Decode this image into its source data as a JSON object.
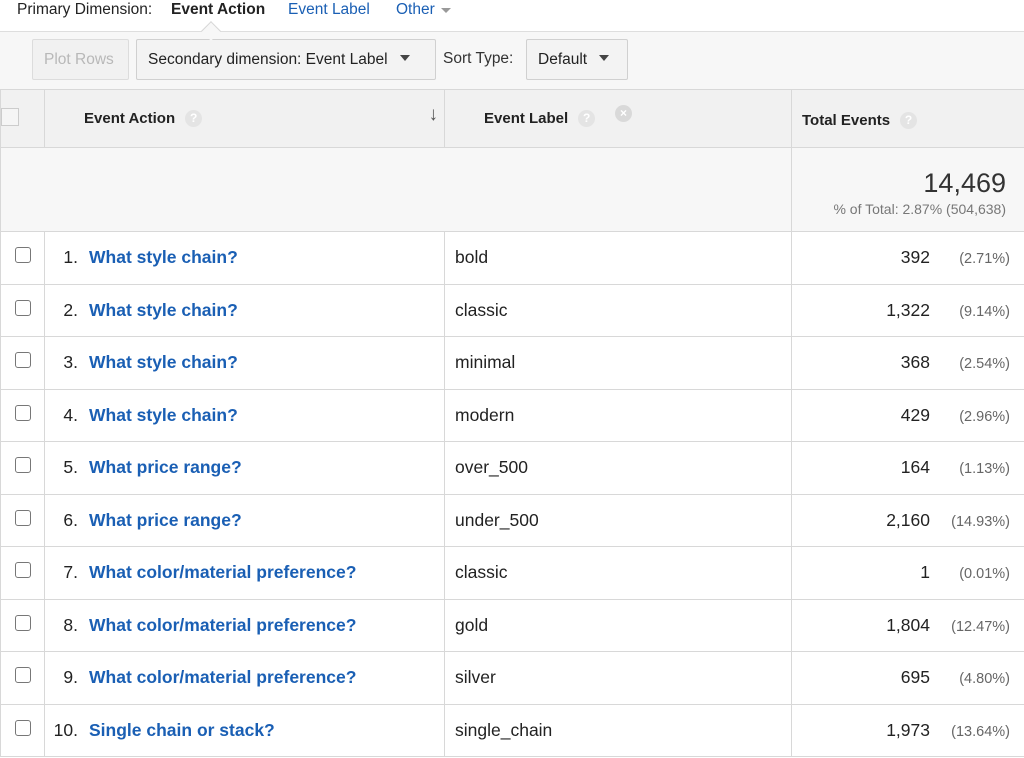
{
  "dimension_bar": {
    "label": "Primary Dimension:",
    "active": "Event Action",
    "option_event_label": "Event Label",
    "option_other": "Other"
  },
  "toolbar": {
    "plot_rows": "Plot Rows",
    "secondary_dimension": "Secondary dimension: Event Label",
    "sort_type_label": "Sort Type:",
    "sort_type_value": "Default"
  },
  "table": {
    "headers": {
      "event_action": "Event Action",
      "event_label": "Event Label",
      "total_events": "Total Events",
      "help_glyph": "?",
      "remove_glyph": "×",
      "sort_glyph": "↓"
    },
    "totals": {
      "value": "14,469",
      "subtext": "% of Total: 2.87% (504,638)"
    },
    "rows": [
      {
        "num": "1.",
        "action": "What style chain?",
        "label": "bold",
        "events": "392",
        "pct": "(2.71%)"
      },
      {
        "num": "2.",
        "action": "What style chain?",
        "label": "classic",
        "events": "1,322",
        "pct": "(9.14%)"
      },
      {
        "num": "3.",
        "action": "What style chain?",
        "label": "minimal",
        "events": "368",
        "pct": "(2.54%)"
      },
      {
        "num": "4.",
        "action": "What style chain?",
        "label": "modern",
        "events": "429",
        "pct": "(2.96%)"
      },
      {
        "num": "5.",
        "action": "What price range?",
        "label": "over_500",
        "events": "164",
        "pct": "(1.13%)"
      },
      {
        "num": "6.",
        "action": "What price range?",
        "label": "under_500",
        "events": "2,160",
        "pct": "(14.93%)"
      },
      {
        "num": "7.",
        "action": "What color/material preference?",
        "label": "classic",
        "events": "1",
        "pct": "(0.01%)"
      },
      {
        "num": "8.",
        "action": "What color/material preference?",
        "label": "gold",
        "events": "1,804",
        "pct": "(12.47%)"
      },
      {
        "num": "9.",
        "action": "What color/material preference?",
        "label": "silver",
        "events": "695",
        "pct": "(4.80%)"
      },
      {
        "num": "10.",
        "action": "Single chain or stack?",
        "label": "single_chain",
        "events": "1,973",
        "pct": "(13.64%)"
      }
    ]
  },
  "colors": {
    "link": "#1a5fb4",
    "header_bg": "#f1f1f1",
    "toolbar_bg": "#f7f7f7"
  }
}
